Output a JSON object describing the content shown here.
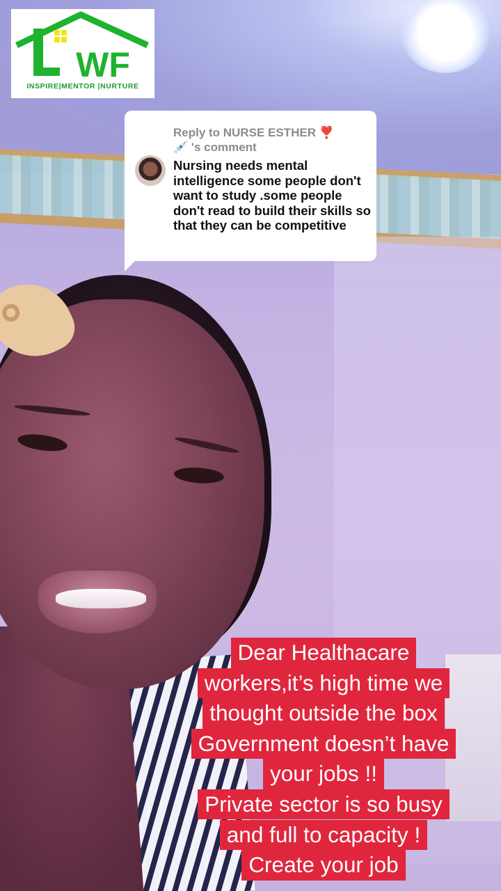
{
  "logo": {
    "letters": "LWF",
    "tagline": "INSPIRE|MENTOR |NURTURE",
    "colors": {
      "green": "#1fb22f",
      "yellow": "#f3e41c"
    }
  },
  "reply": {
    "title_prefix": "Reply to NURSE ESTHER",
    "heart": "❣️",
    "syringe": "💉",
    "title_suffix": "'s comment",
    "body": "Nursing needs mental intelligence some people don't want to study .some people don't read to build their skills so that they can be competitive"
  },
  "caption": {
    "lines": [
      "Dear Healthacare",
      "workers,it’s high time we",
      "thought outside the box",
      "Government doesn’t have",
      "your jobs !!",
      "Private sector is so busy",
      "and full to capacity !",
      "Create your job"
    ],
    "background_color": "#e0263d",
    "text_color": "#ffffff"
  }
}
